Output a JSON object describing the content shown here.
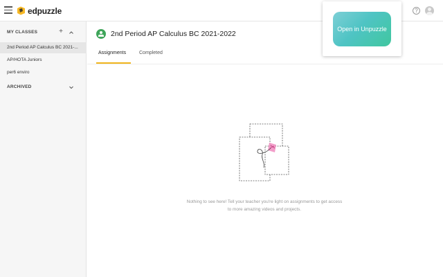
{
  "header": {
    "logo_text": "edpuzzle",
    "help_glyph": "?",
    "icons": [
      "menu-icon",
      "edpuzzle-logo-icon",
      "help-icon",
      "user-avatar-icon"
    ]
  },
  "sidebar": {
    "my_classes_label": "MY CLASSES",
    "add_glyph": "+",
    "classes": [
      {
        "label": "2nd Period AP Calculus BC 2021-..."
      },
      {
        "label": "AP/HOTA Juniors"
      },
      {
        "label": "per6 enviro"
      }
    ],
    "archived_label": "ARCHIVED"
  },
  "main": {
    "class_title": "2nd Period AP Calculus BC 2021-2022",
    "tabs": [
      {
        "label": "Assignments"
      },
      {
        "label": "Completed"
      }
    ],
    "empty_message": "Nothing to see here! Tell your teacher you're light on assignments to get access to more amazing videos and projects."
  },
  "popup": {
    "button_label": "Open in Unpuzzle"
  },
  "colors": {
    "accent_tab": "#f0b41c",
    "class_avatar": "#3fa55a",
    "popup_gradient_start": "#7dcfd6",
    "popup_gradient_end": "#40c79f",
    "illustration_pink": "#f08cbf"
  }
}
